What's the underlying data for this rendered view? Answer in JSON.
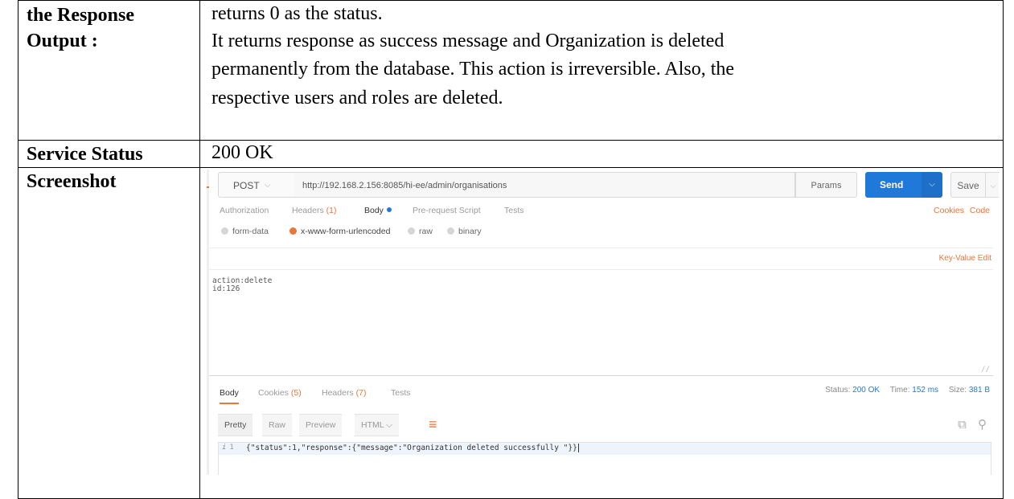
{
  "table": {
    "row1": {
      "label": "the Response Output :",
      "paragraphs": [
        "returns 0 as the status.",
        "It returns response as success message and Organization is deleted",
        "permanently from the database. This action is irreversible. Also, the",
        "respective users and roles are deleted."
      ]
    },
    "row2": {
      "label": "Service Status",
      "value": "200 OK"
    },
    "row3": {
      "label": "Screenshot"
    }
  },
  "screenshot": {
    "method": "POST",
    "url": "http://192.168.2.156:8085/hi-ee/admin/organisations",
    "params_label": "Params",
    "send_label": "Send",
    "save_label": "Save",
    "request_tabs": {
      "authorization": "Authorization",
      "headers": "Headers",
      "headers_count": "(1)",
      "body": "Body",
      "prerequest": "Pre-request Script",
      "tests": "Tests"
    },
    "cookies_link": "Cookies",
    "code_link": "Code",
    "body_modes": [
      "form-data",
      "x-www-form-urlencoded",
      "raw",
      "binary"
    ],
    "selected_body_mode": "x-www-form-urlencoded",
    "key_value_edit": "Key-Value Edit",
    "body_lines": [
      "action:delete",
      "id:126"
    ],
    "response_tabs": {
      "body": "Body",
      "cookies": "Cookies",
      "cookies_count": "(5)",
      "headers": "Headers",
      "headers_count": "(7)",
      "tests": "Tests"
    },
    "status_label": "Status:",
    "status_value": "200 OK",
    "time_label": "Time:",
    "time_value": "152 ms",
    "size_label": "Size:",
    "size_value": "381 B",
    "format_buttons": [
      "Pretty",
      "Raw",
      "Preview"
    ],
    "format_type": "HTML",
    "line_number": "1",
    "response_json": "{\"status\":1,\"response\":{\"message\":\"Organization deleted successfully \"}}",
    "colors": {
      "accent": "#e8773a",
      "send": "#1f79d9"
    }
  }
}
